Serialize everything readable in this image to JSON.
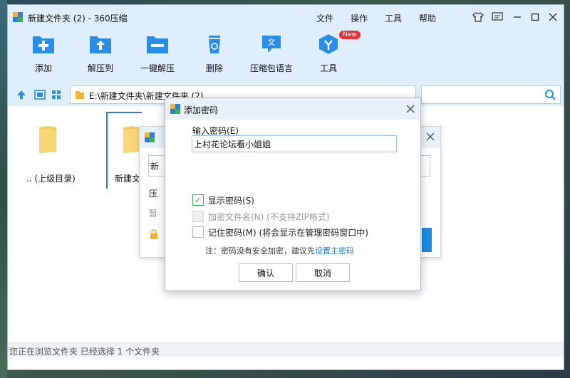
{
  "window": {
    "title": "新建文件夹 (2) - 360压缩",
    "menus": [
      "文件",
      "操作",
      "工具",
      "帮助"
    ]
  },
  "toolbar": {
    "add": "添加",
    "extract_to": "解压到",
    "one_click": "一键解压",
    "delete": "删除",
    "comment_lang": "压缩包语言",
    "tools": "工具",
    "new_badge": "New"
  },
  "address": {
    "path": "E:\\新建文件夹\\新建文件夹 (2)"
  },
  "files": {
    "items": [
      {
        "label": ".. (上级目录)"
      },
      {
        "label": "新建文"
      }
    ]
  },
  "status": {
    "text": "您正在浏览文件夹 已经选择 1 个文件夹"
  },
  "bg_dialog": {
    "c1": "新",
    "c2": "压",
    "c3": "暂"
  },
  "dialog": {
    "title": "添加密码",
    "password_label": "输入密码(E)",
    "password_value": "上村花论坛看小姐姐",
    "show_password": "显示密码(S)",
    "encrypt_names": "加密文件名(N) (不支持ZIP格式)",
    "remember": "记住密码(M) (将会显示在管理密码窗口中)",
    "note_prefix": "注：密码没有安全加密，建议先",
    "note_link": "设置主密码",
    "ok": "确认",
    "cancel": "取消"
  },
  "colors": {
    "accent": "#1e7fd6",
    "title_bg": "#dfeefc",
    "folder": "#f7c95e"
  }
}
